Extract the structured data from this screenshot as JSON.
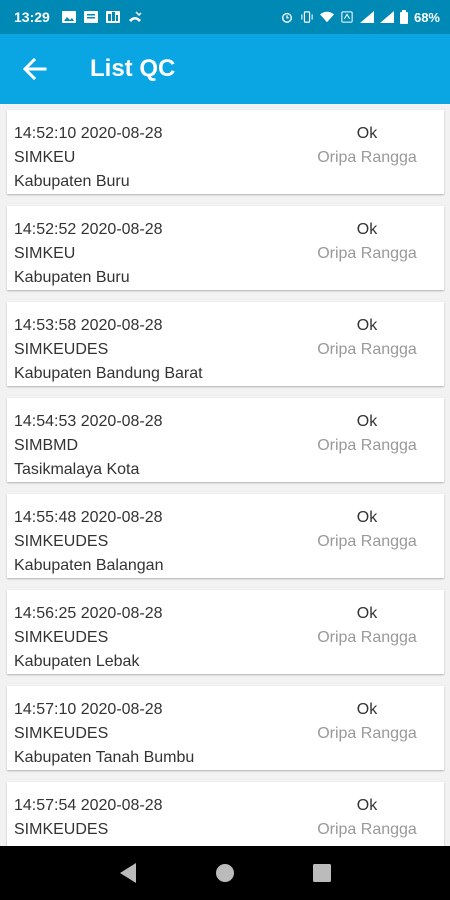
{
  "status_bar": {
    "time": "13:29",
    "battery": "68%"
  },
  "app_bar": {
    "title": "List QC"
  },
  "items": [
    {
      "datetime": "14:52:10 2020-08-28",
      "app": "SIMKEU",
      "region": "Kabupaten Buru",
      "status": "Ok",
      "user": "Oripa Rangga"
    },
    {
      "datetime": "14:52:52 2020-08-28",
      "app": "SIMKEU",
      "region": "Kabupaten Buru",
      "status": "Ok",
      "user": "Oripa Rangga"
    },
    {
      "datetime": "14:53:58 2020-08-28",
      "app": "SIMKEUDES",
      "region": "Kabupaten Bandung Barat",
      "status": "Ok",
      "user": "Oripa Rangga"
    },
    {
      "datetime": "14:54:53 2020-08-28",
      "app": "SIMBMD",
      "region": "Tasikmalaya Kota",
      "status": "Ok",
      "user": "Oripa Rangga"
    },
    {
      "datetime": "14:55:48 2020-08-28",
      "app": "SIMKEUDES",
      "region": "Kabupaten Balangan",
      "status": "Ok",
      "user": "Oripa Rangga"
    },
    {
      "datetime": "14:56:25 2020-08-28",
      "app": "SIMKEUDES",
      "region": "Kabupaten Lebak",
      "status": "Ok",
      "user": "Oripa Rangga"
    },
    {
      "datetime": "14:57:10 2020-08-28",
      "app": "SIMKEUDES",
      "region": "Kabupaten Tanah Bumbu",
      "status": "Ok",
      "user": "Oripa Rangga"
    },
    {
      "datetime": "14:57:54 2020-08-28",
      "app": "SIMKEUDES",
      "region": "",
      "status": "Ok",
      "user": "Oripa Rangga"
    }
  ],
  "colors": {
    "status_bar": "#0089b4",
    "app_bar": "#0aa5e3",
    "background": "#f2f2f2"
  },
  "icons": {
    "back": "arrow-left-icon",
    "nav_back": "triangle-back-icon",
    "nav_home": "circle-home-icon",
    "nav_recents": "square-recents-icon"
  }
}
